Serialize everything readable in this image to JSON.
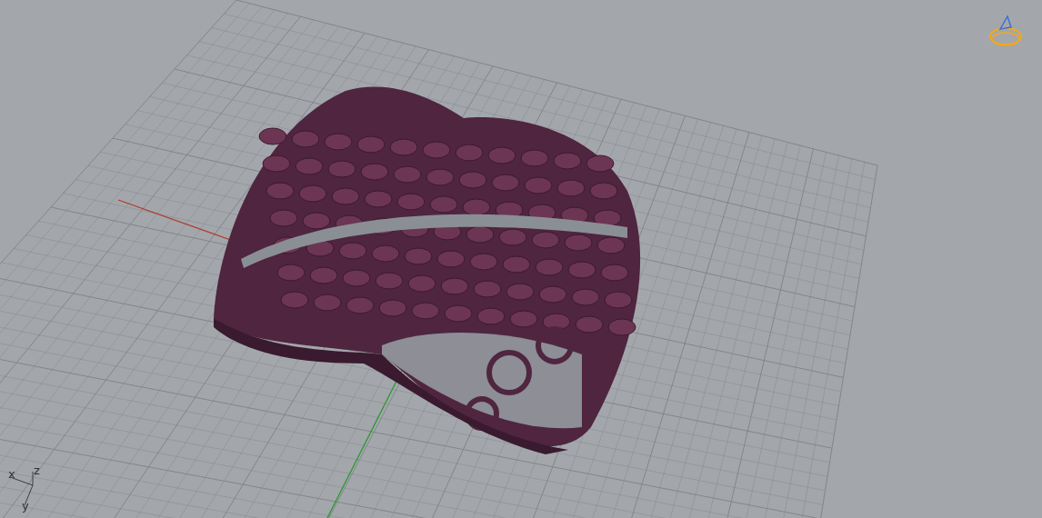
{
  "viewport": {
    "axis_labels": [
      "x",
      "z",
      "y"
    ]
  }
}
